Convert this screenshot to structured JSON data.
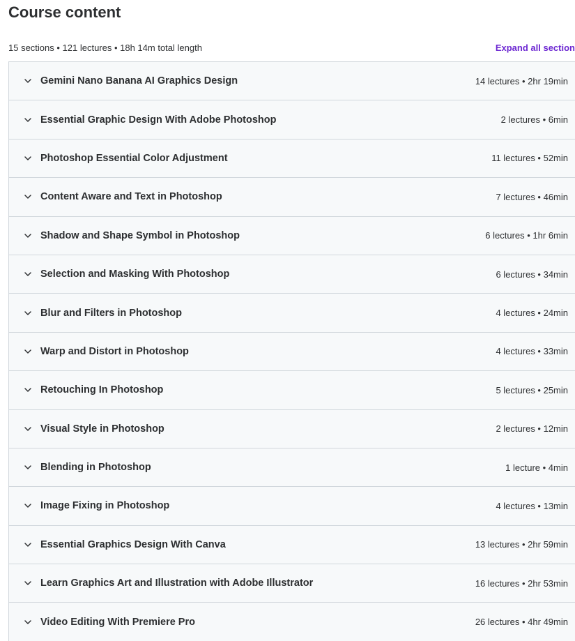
{
  "heading": "Course content",
  "summary": "15 sections • 121 lectures • 18h 14m total length",
  "expand_all_label": "Expand all section",
  "colors": {
    "accent": "#6d28d2",
    "row_bg": "#f7f9fa",
    "border": "#d1d7dc",
    "text": "#2d2f31"
  },
  "chevron_icon": "chevron-down-icon",
  "sections": [
    {
      "title": "Gemini Nano Banana AI Graphics Design",
      "meta": "14 lectures • 2hr 19min"
    },
    {
      "title": "Essential Graphic Design With Adobe Photoshop",
      "meta": "2 lectures • 6min"
    },
    {
      "title": "Photoshop Essential Color Adjustment",
      "meta": "11 lectures • 52min"
    },
    {
      "title": "Content Aware and Text in Photoshop",
      "meta": "7 lectures • 46min"
    },
    {
      "title": "Shadow and Shape Symbol in Photoshop",
      "meta": "6 lectures • 1hr 6min"
    },
    {
      "title": "Selection and Masking With Photoshop",
      "meta": "6 lectures • 34min"
    },
    {
      "title": "Blur and Filters in Photoshop",
      "meta": "4 lectures • 24min"
    },
    {
      "title": "Warp and Distort in Photoshop",
      "meta": "4 lectures • 33min"
    },
    {
      "title": "Retouching In Photoshop",
      "meta": "5 lectures • 25min"
    },
    {
      "title": "Visual Style in Photoshop",
      "meta": "2 lectures • 12min"
    },
    {
      "title": "Blending in Photoshop",
      "meta": "1 lecture • 4min"
    },
    {
      "title": "Image Fixing in Photoshop",
      "meta": "4 lectures • 13min"
    },
    {
      "title": "Essential Graphics Design With Canva",
      "meta": "13 lectures • 2hr 59min"
    },
    {
      "title": "Learn Graphics Art and Illustration with Adobe Illustrator",
      "meta": "16 lectures • 2hr 53min"
    },
    {
      "title": "Video Editing With Premiere Pro",
      "meta": "26 lectures • 4hr 49min"
    }
  ]
}
